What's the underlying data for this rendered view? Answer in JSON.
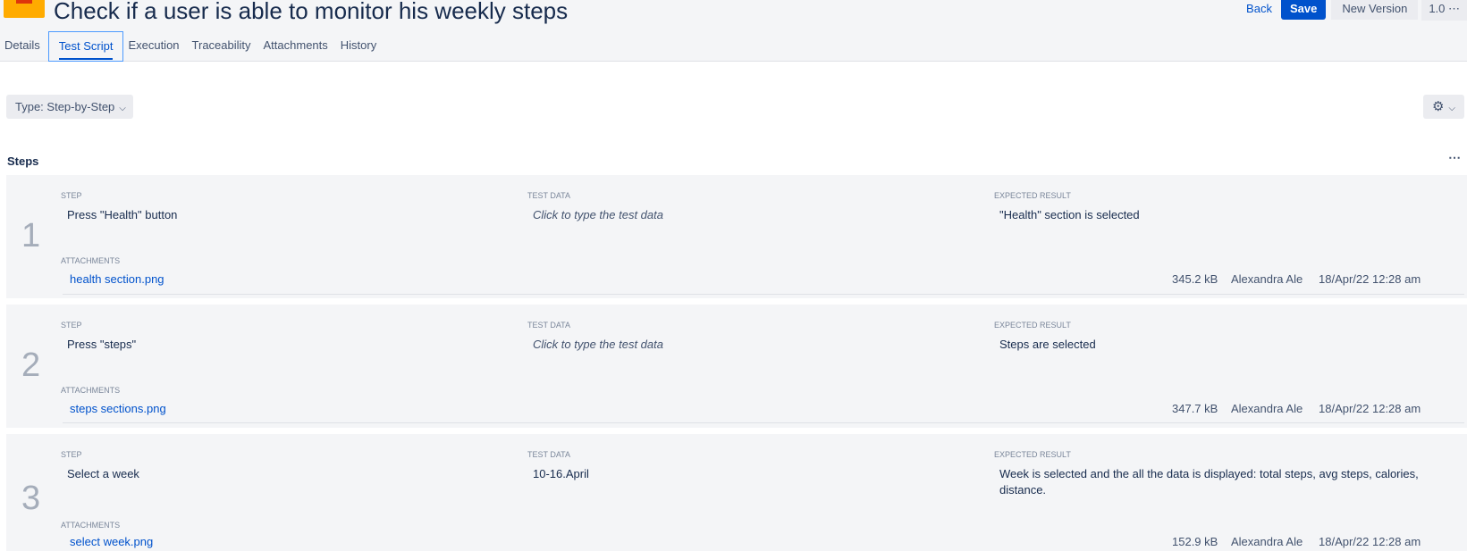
{
  "header": {
    "title": "Check if a user is able to monitor his weekly steps",
    "back_label": "Back",
    "save_label": "Save",
    "new_version_label": "New Version",
    "version_label": "1.0 ⋯"
  },
  "tabs": [
    {
      "label": "Details"
    },
    {
      "label": "Test Script"
    },
    {
      "label": "Execution"
    },
    {
      "label": "Traceability"
    },
    {
      "label": "Attachments"
    },
    {
      "label": "History"
    }
  ],
  "active_tab": "Test Script",
  "toolbar": {
    "type_label": "Type: Step-by-Step",
    "settings_icon": "gear-icon"
  },
  "steps_section": {
    "title": "Steps",
    "more_label": "⋯"
  },
  "column_labels": {
    "step": "STEP",
    "test_data": "TEST DATA",
    "expected_result": "EXPECTED RESULT",
    "attachments": "ATTACHMENTS"
  },
  "steps": [
    {
      "number": "1",
      "step": "Press \"Health\" button",
      "test_data": "Click to type the test data",
      "expected": "\"Health\"  section is selected",
      "attachment": {
        "name": "health section.png",
        "size": "345.2 kB",
        "author": "Alexandra Ale",
        "date": "18/Apr/22 12:28 am"
      }
    },
    {
      "number": "2",
      "step": "Press \"steps\"",
      "test_data": "Click to type the test data",
      "expected": "Steps are selected",
      "attachment": {
        "name": "steps sections.png",
        "size": "347.7 kB",
        "author": "Alexandra Ale",
        "date": "18/Apr/22 12:28 am"
      }
    },
    {
      "number": "3",
      "step": "Select a week",
      "test_data": "10-16.April",
      "expected_line1": "Week is selected and the all the data is displayed: total steps, avg steps, calories,",
      "expected_line2": "distance.",
      "attachment": {
        "name": "select week.png",
        "size": "152.9 kB",
        "author": "Alexandra Ale",
        "date": "18/Apr/22 12:28 am"
      }
    }
  ],
  "colors": {
    "accent": "#0052cc",
    "header_bg": "#f4f5f7",
    "step_bg": "#f4f5f7",
    "logo": "#ffab00"
  }
}
